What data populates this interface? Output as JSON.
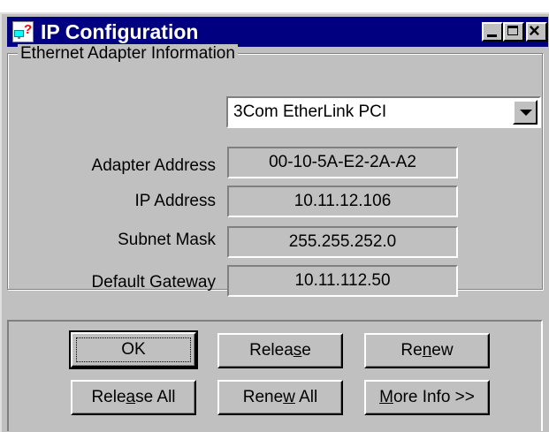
{
  "window": {
    "title": "IP Configuration",
    "icon": "network-question-icon",
    "controls": {
      "minimize": "minimize-icon",
      "maximize": "maximize-icon",
      "close": "×"
    }
  },
  "adapter_group": {
    "legend": "Ethernet  Adapter Information",
    "adapter_select": "3Com EtherLink PCI",
    "fields": {
      "adapter_address_label": "Adapter Address",
      "adapter_address": "00-10-5A-E2-2A-A2",
      "ip_address_label": "IP Address",
      "ip_address": "10.11.12.106",
      "subnet_mask_label": "Subnet Mask",
      "subnet_mask": "255.255.252.0",
      "default_gateway_label": "Default Gateway",
      "default_gateway": "10.11.112.50"
    }
  },
  "buttons": {
    "ok": "OK",
    "release_pre": "Relea",
    "release_key": "s",
    "release_post": "e",
    "renew_pre": "Re",
    "renew_key": "n",
    "renew_post": "ew",
    "release_all_pre": "Rele",
    "release_all_key": "a",
    "release_all_post": "se All",
    "renew_all_pre": "Rene",
    "renew_all_key": "w",
    "renew_all_post": " All",
    "more_info_key": "M",
    "more_info_post": "ore Info >>"
  },
  "colors": {
    "titlebar": "#000080",
    "face": "#c0c0c0"
  }
}
